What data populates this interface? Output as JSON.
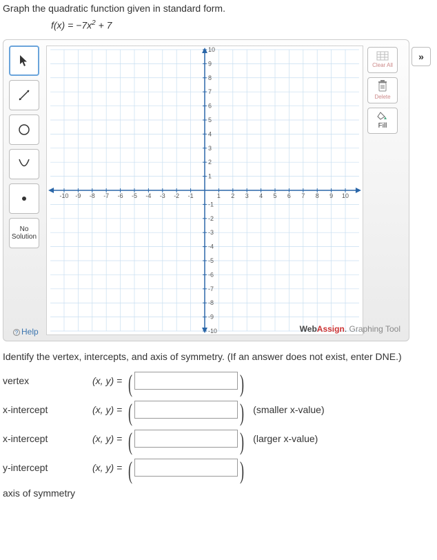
{
  "question": {
    "prompt": "Graph the quadratic function given in standard form.",
    "function_prefix": "f(x) = −7x",
    "function_exponent": "2",
    "function_suffix": " + 7"
  },
  "toolbar": {
    "nosol_line1": "No",
    "nosol_line2": "Solution"
  },
  "right_tools": {
    "clear": "Clear All",
    "delete": "Delete",
    "fill": "Fill"
  },
  "graph": {
    "ticks_x_neg": [
      "-10",
      "-9",
      "-8",
      "-7",
      "-6",
      "-5",
      "-4",
      "-3",
      "-2",
      "-1"
    ],
    "ticks_x_pos": [
      "1",
      "2",
      "3",
      "4",
      "5",
      "6",
      "7",
      "8",
      "9",
      "10"
    ],
    "ticks_y_neg": [
      "-1",
      "-2",
      "-3",
      "-4",
      "-5",
      "-6",
      "-7",
      "-8",
      "-9",
      "-10"
    ],
    "ticks_y_pos": [
      "1",
      "2",
      "3",
      "4",
      "5",
      "6",
      "7",
      "8",
      "9",
      "10"
    ]
  },
  "branding": {
    "web": "Web",
    "assign": "Assign",
    "dot": ".",
    "sub": " Graphing Tool"
  },
  "help": "Help",
  "identify": "Identify the vertex, intercepts, and axis of symmetry. (If an answer does not exist, enter DNE.)",
  "rows": {
    "vertex": {
      "label": "vertex",
      "xy": "(x, y)  ="
    },
    "xint1": {
      "label": "x-intercept",
      "xy": "(x, y)  =",
      "hint": "(smaller x-value)"
    },
    "xint2": {
      "label": "x-intercept",
      "xy": "(x, y)  =",
      "hint": "(larger x-value)"
    },
    "yint": {
      "label": "y-intercept",
      "xy": "(x, y)  ="
    },
    "axis": {
      "label": "axis of symmetry"
    }
  },
  "expand": "»",
  "chart_data": {
    "type": "scatter",
    "title": "",
    "xlabel": "",
    "ylabel": "",
    "xlim": [
      -10,
      10
    ],
    "ylim": [
      -10,
      10
    ],
    "xticks": [
      -10,
      -9,
      -8,
      -7,
      -6,
      -5,
      -4,
      -3,
      -2,
      -1,
      1,
      2,
      3,
      4,
      5,
      6,
      7,
      8,
      9,
      10
    ],
    "yticks": [
      -10,
      -9,
      -8,
      -7,
      -6,
      -5,
      -4,
      -3,
      -2,
      -1,
      1,
      2,
      3,
      4,
      5,
      6,
      7,
      8,
      9,
      10
    ],
    "grid": true,
    "series": []
  }
}
